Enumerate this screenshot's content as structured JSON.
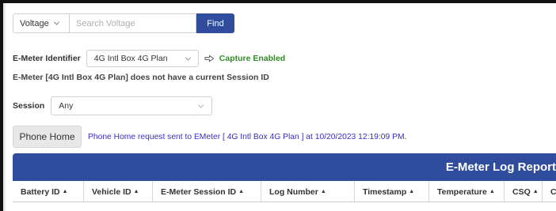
{
  "search": {
    "type_value": "Voltage",
    "placeholder": "Search Voltage",
    "find_label": "Find"
  },
  "emeter": {
    "identifier_label": "E-Meter Identifier",
    "identifier_value": "4G Intl Box 4G Plan",
    "capture_status": "Capture Enabled",
    "session_note": "E-Meter [4G Intl Box 4G Plan] does not have a current Session ID"
  },
  "session": {
    "label": "Session",
    "value": "Any"
  },
  "phone_home": {
    "button_label": "Phone Home",
    "message": "Phone Home request sent to EMeter [ 4G Intl Box 4G Plan ] at 10/20/2023 12:19:09 PM."
  },
  "report": {
    "title": "E-Meter Log Report",
    "columns": [
      {
        "label": "Battery ID",
        "sort": "▲"
      },
      {
        "label": "Vehicle ID",
        "sort": "▲"
      },
      {
        "label": "E-Meter Session ID",
        "sort": "▲"
      },
      {
        "label": "Log Number",
        "sort": "▲"
      },
      {
        "label": "Timestamp",
        "sort": "▲"
      },
      {
        "label": "Temperature",
        "sort": "▲"
      },
      {
        "label": "CSQ",
        "sort": "▲"
      },
      {
        "label": "Cu",
        "sort": ""
      }
    ]
  },
  "colors": {
    "primary": "#2f4d9c",
    "capture_green": "#2e8b25",
    "message_purple": "#3a2ec2"
  },
  "icons": {
    "dropdown": "chevron-down-icon",
    "capture": "arrow-right-icon"
  }
}
